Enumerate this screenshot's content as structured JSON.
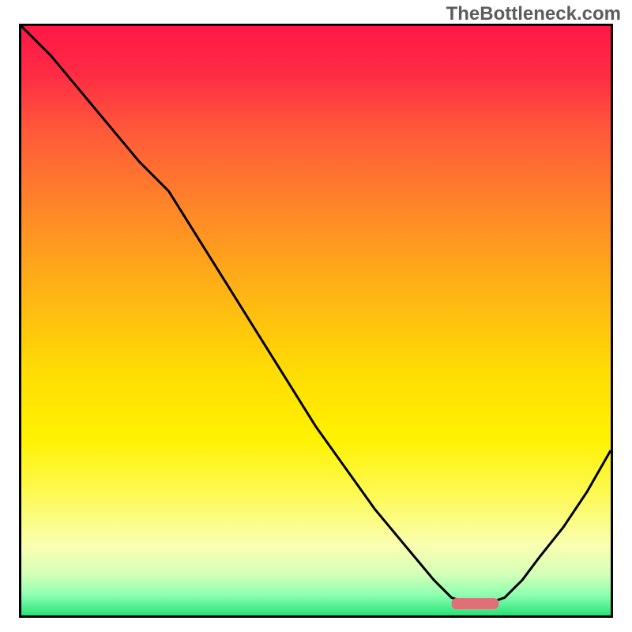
{
  "watermark": "TheBottleneck.com",
  "colors": {
    "border": "#000000",
    "watermark_text": "#5c5c5c",
    "curve_stroke": "#000000",
    "marker": "#e07078",
    "gradient_stops": [
      {
        "offset": 0.0,
        "color": "#ff1846"
      },
      {
        "offset": 0.08,
        "color": "#ff2b44"
      },
      {
        "offset": 0.18,
        "color": "#ff5a39"
      },
      {
        "offset": 0.3,
        "color": "#ff8329"
      },
      {
        "offset": 0.45,
        "color": "#ffb315"
      },
      {
        "offset": 0.58,
        "color": "#ffdb05"
      },
      {
        "offset": 0.7,
        "color": "#fff200"
      },
      {
        "offset": 0.8,
        "color": "#fdfa5a"
      },
      {
        "offset": 0.88,
        "color": "#faffb0"
      },
      {
        "offset": 0.93,
        "color": "#d4ffb8"
      },
      {
        "offset": 0.965,
        "color": "#8effb0"
      },
      {
        "offset": 1.0,
        "color": "#26e37a"
      }
    ]
  },
  "chart_data": {
    "type": "line",
    "title": "",
    "xlabel": "",
    "ylabel": "",
    "xlim": [
      0,
      100
    ],
    "ylim": [
      0,
      100
    ],
    "grid": false,
    "series": [
      {
        "name": "bottleneck-curve",
        "x": [
          0,
          5,
          10,
          15,
          20,
          25,
          30,
          35,
          40,
          45,
          50,
          55,
          60,
          65,
          70,
          73,
          76,
          79,
          82,
          85,
          88,
          92,
          96,
          100
        ],
        "values": [
          100,
          95,
          89,
          83,
          77,
          72,
          64,
          56,
          48,
          40,
          32,
          25,
          18,
          12,
          6,
          3,
          2,
          2,
          3,
          6,
          10,
          15,
          21,
          28
        ]
      }
    ],
    "annotations": [
      {
        "name": "optimal-marker",
        "x_start": 73,
        "x_end": 81,
        "y": 2
      }
    ]
  }
}
